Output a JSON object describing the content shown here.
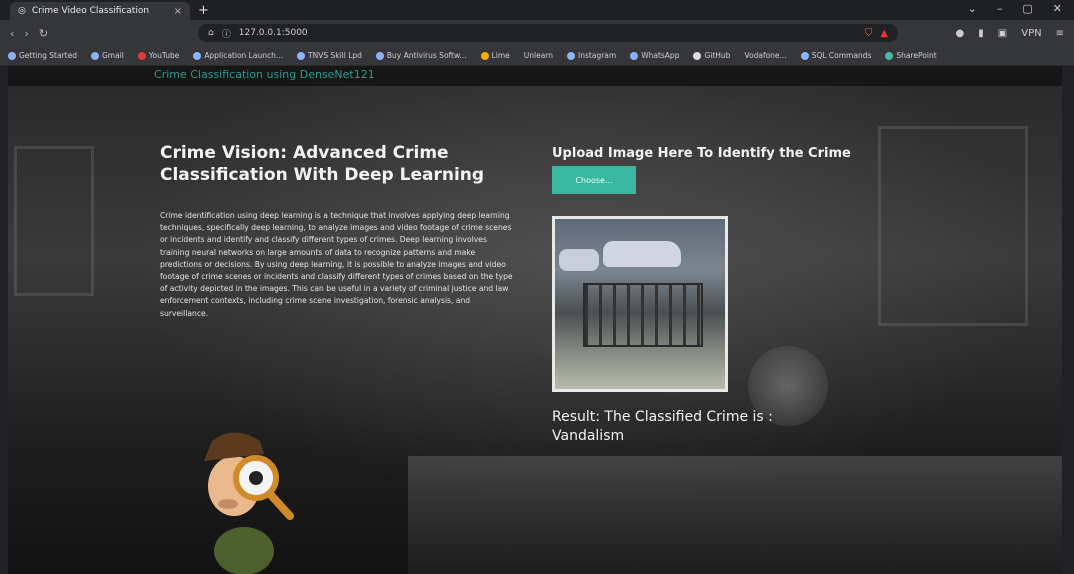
{
  "browser": {
    "tab_title": "Crime Video Classification",
    "url": "127.0.0.1:5000",
    "bookmarks": [
      "Getting Started",
      "Gmail",
      "YouTube",
      "Application Launch...",
      "TNVS Skill Lpd",
      "Buy Antivirus Softw...",
      "Lime",
      "Unlearn",
      "Instagram",
      "WhatsApp",
      "GitHub",
      "Vodafone...",
      "SQL Commands",
      "SharePoint"
    ]
  },
  "page": {
    "brand": "Crime Classification using DenseNet121",
    "headline": "Crime Vision: Advanced Crime Classification With Deep Learning",
    "description": "Crime identification using deep learning is a technique that involves applying deep learning techniques, specifically deep learning, to analyze images and video footage of crime scenes or incidents and identify and classify different types of crimes. Deep learning involves training neural networks on large amounts of data to recognize patterns and make predictions or decisions. By using deep learning, it is possible to analyze images and video footage of crime scenes or incidents and classify different types of crimes based on the type of activity depicted in the images. This can be useful in a variety of criminal justice and law enforcement contexts, including crime scene investigation, forensic analysis, and surveillance.",
    "upload_title": "Upload Image Here To Identify the Crime",
    "choose_button": "Choose...",
    "result_label": "Result: The Classified Crime is :",
    "result_value": "Vandalism"
  },
  "colors": {
    "accent": "#3ab7a1",
    "brand_text": "#2f9a8c"
  }
}
